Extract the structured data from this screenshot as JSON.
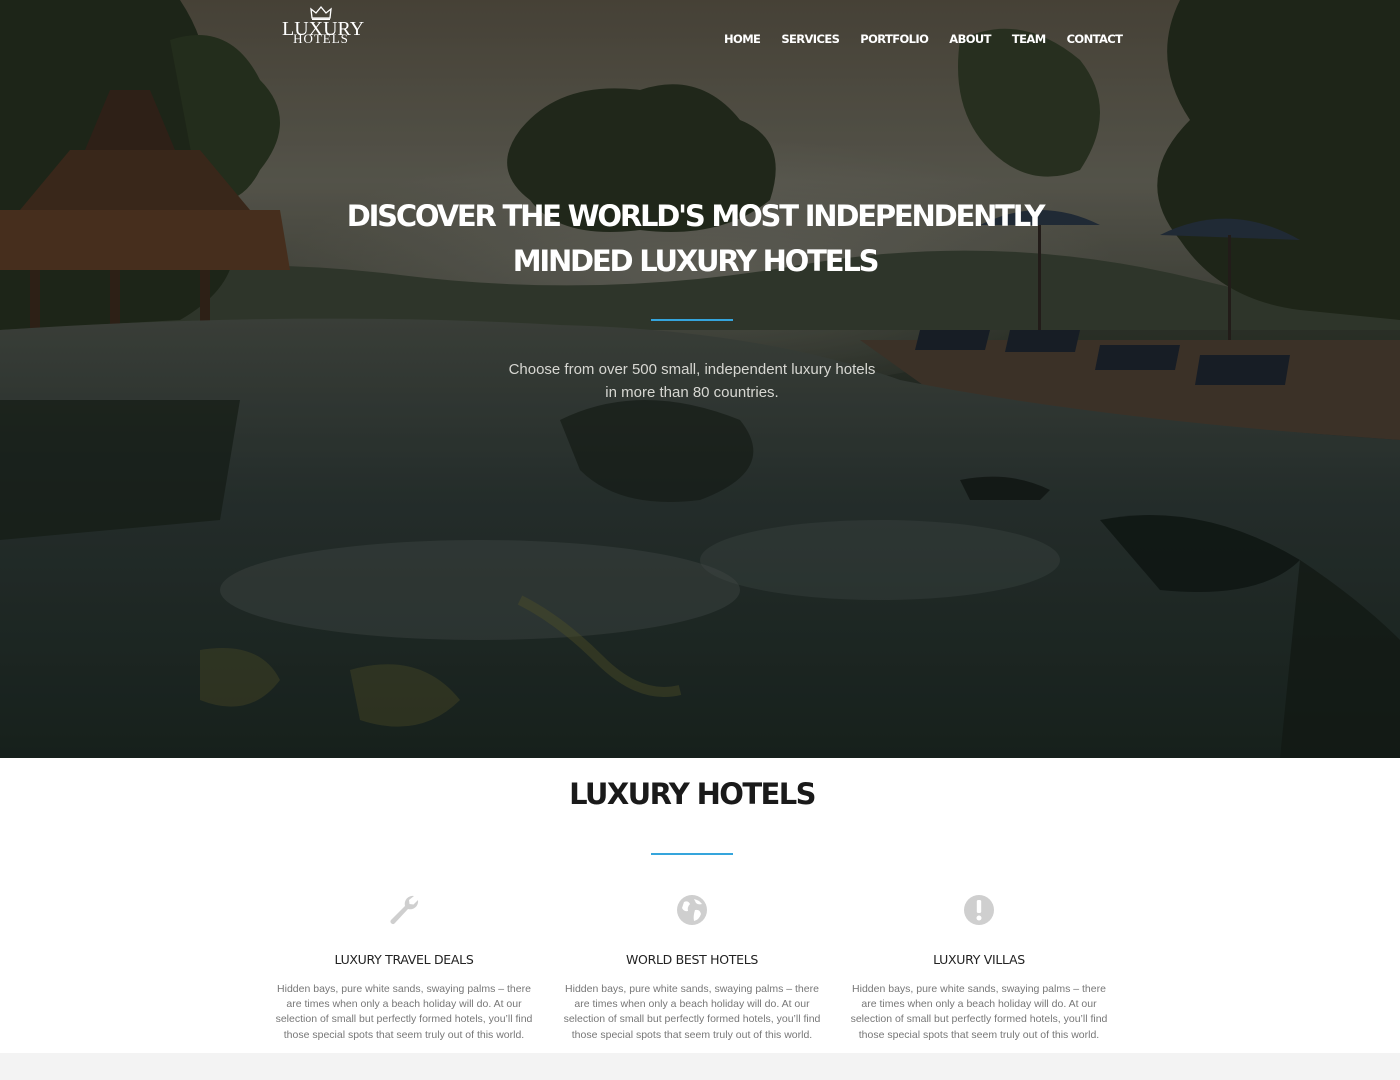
{
  "brand": {
    "line1": "LUXURY",
    "line2": "HOTELS",
    "icon": "crown-icon"
  },
  "nav": {
    "items": [
      {
        "label": "HOME"
      },
      {
        "label": "SERVICES"
      },
      {
        "label": "PORTFOLIO"
      },
      {
        "label": "ABOUT"
      },
      {
        "label": "TEAM"
      },
      {
        "label": "CONTACT"
      }
    ]
  },
  "hero": {
    "title_line1": "DISCOVER THE WORLD'S MOST INDEPENDENTLY",
    "title_line2": "MINDED LUXURY HOTELS",
    "subtitle_line1": "Choose from over 500 small, independent luxury hotels",
    "subtitle_line2": "in more than 80 countries."
  },
  "services": {
    "title": "LUXURY HOTELS",
    "accent_color": "#35a5dc",
    "features": [
      {
        "icon": "wrench-icon",
        "title": "LUXURY TRAVEL DEALS",
        "text": "Hidden bays, pure white sands, swaying palms – there are times when only a beach holiday will do. At our selection of small but perfectly formed hotels, you’ll find those special spots that seem truly out of this world."
      },
      {
        "icon": "globe-icon",
        "title": "WORLD BEST HOTELS",
        "text": "Hidden bays, pure white sands, swaying palms – there are times when only a beach holiday will do. At our selection of small but perfectly formed hotels, you’ll find those special spots that seem truly out of this world."
      },
      {
        "icon": "exclamation-circle-icon",
        "title": "LUXURY VILLAS",
        "text": "Hidden bays, pure white sands, swaying palms – there are times when only a beach holiday will do. At our selection of small but perfectly formed hotels, you’ll find those special spots that seem truly out of this world."
      }
    ]
  }
}
